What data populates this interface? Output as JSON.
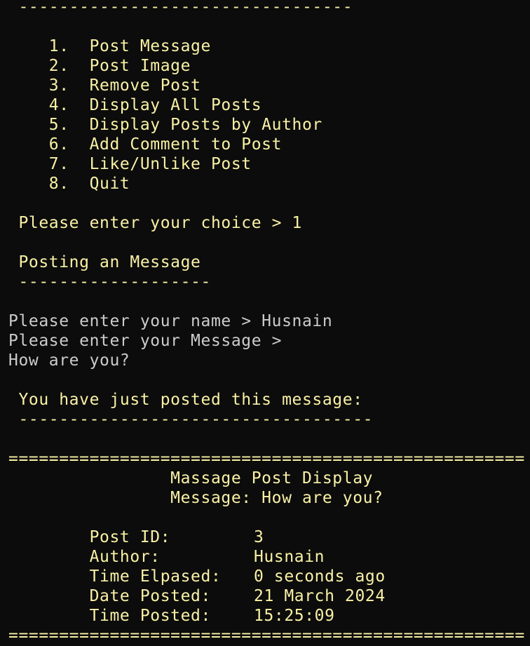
{
  "menu": {
    "top_rule": " ---------------------------------",
    "items": [
      "    1.  Post Message",
      "    2.  Post Image",
      "    3.  Remove Post",
      "    4.  Display All Posts",
      "    5.  Display Posts by Author",
      "    6.  Add Comment to Post",
      "    7.  Like/Unlike Post",
      "    8.  Quit"
    ],
    "choice_prompt": " Please enter your choice > 1"
  },
  "posting": {
    "heading": " Posting an Message",
    "rule": " -------------------",
    "name_prompt": "Please enter your name > Husnain",
    "message_prompt": "Please enter your Message >",
    "message_input": "How are you?",
    "confirm_heading": " You have just posted this message:",
    "confirm_rule": " -----------------------------------"
  },
  "display": {
    "border_top": "===================================================",
    "title": "                Massage Post Display",
    "message_line": "                Message: How are you?",
    "post_id_label": "        Post ID:",
    "post_id_value": "3",
    "author_label": "        Author:",
    "author_value": "Husnain",
    "time_elapsed_label": "        Time Elpased:",
    "time_elapsed_value": "0 seconds ago",
    "date_posted_label": "        Date Posted:",
    "date_posted_value": "21 March 2024",
    "time_posted_label": "        Time Posted:",
    "time_posted_value": "15:25:09",
    "border_bottom": "==================================================="
  },
  "colors": {
    "background": "#0c0c0c",
    "app_output": "#f9f1a5",
    "user_input": "#cccccc"
  }
}
